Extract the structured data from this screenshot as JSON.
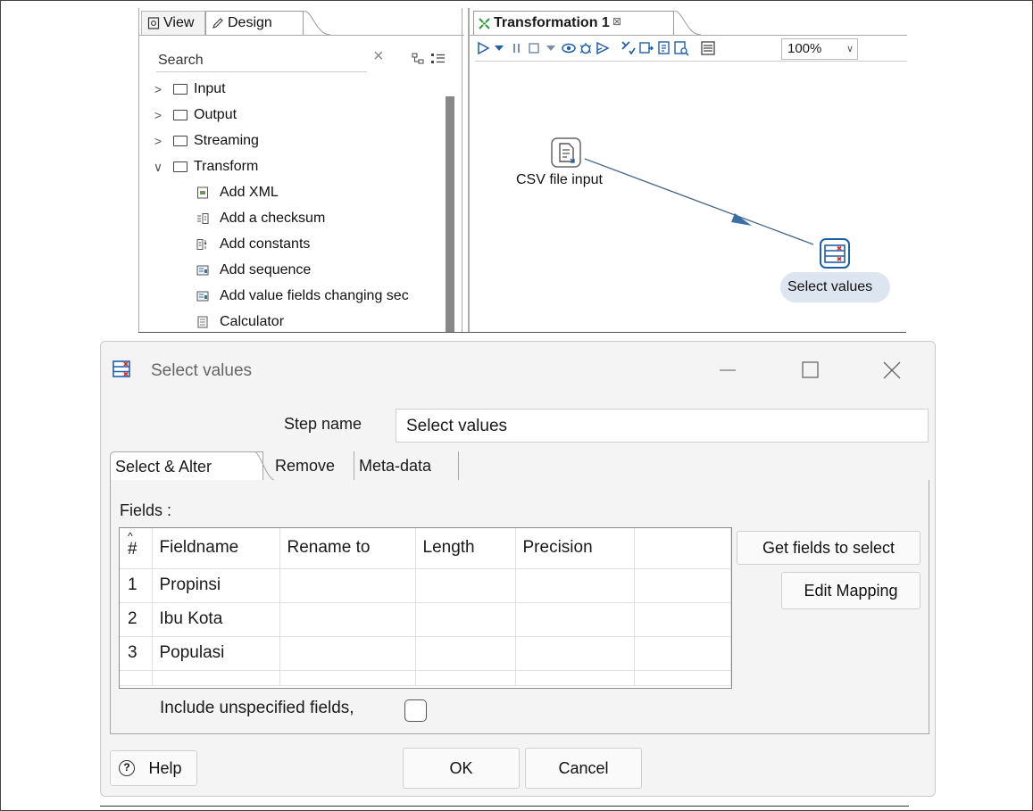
{
  "left_panel": {
    "tabs": [
      {
        "label": "View",
        "icon": "view-icon"
      },
      {
        "label": "Design",
        "icon": "pencil-icon"
      }
    ],
    "search_placeholder": "Search",
    "tree": [
      {
        "label": "Input",
        "expanded": false
      },
      {
        "label": "Output",
        "expanded": false
      },
      {
        "label": "Streaming",
        "expanded": false
      },
      {
        "label": "Transform",
        "expanded": true
      }
    ],
    "transform_steps": [
      {
        "label": "Add XML",
        "icon": "add-xml-icon"
      },
      {
        "label": "Add a checksum",
        "icon": "checksum-icon"
      },
      {
        "label": "Add constants",
        "icon": "constants-icon"
      },
      {
        "label": "Add sequence",
        "icon": "sequence-icon"
      },
      {
        "label": "Add value fields changing sec",
        "icon": "value-fields-icon"
      },
      {
        "label": "Calculator",
        "icon": "calculator-icon"
      }
    ]
  },
  "editor": {
    "tab_title": "Transformation 1",
    "zoom": "100%",
    "steps": [
      {
        "label": "CSV file input",
        "icon": "csv-file-icon"
      },
      {
        "label": "Select values",
        "icon": "select-values-icon",
        "selected": true
      }
    ]
  },
  "dialog": {
    "title": "Select values",
    "step_name_label": "Step name",
    "step_name_value": "Select values",
    "tabs": [
      "Select & Alter",
      "Remove",
      "Meta-data"
    ],
    "active_tab": "Select & Alter",
    "fields_label": "Fields :",
    "columns": [
      "#",
      "Fieldname",
      "Rename to",
      "Length",
      "Precision",
      ""
    ],
    "rows": [
      {
        "num": "1",
        "fieldname": "Propinsi"
      },
      {
        "num": "2",
        "fieldname": "Ibu Kota"
      },
      {
        "num": "3",
        "fieldname": "Populasi"
      }
    ],
    "get_fields_label": "Get fields to select",
    "edit_mapping_label": "Edit Mapping",
    "include_label": "Include unspecified fields,",
    "include_checked": false,
    "help_label": "Help",
    "ok_label": "OK",
    "cancel_label": "Cancel"
  },
  "colors": {
    "accent_blue": "#1f5fa8",
    "green_icon": "#2e9e3e",
    "dialog_bg": "#f4f4f4",
    "selection_bg": "#dde6f0"
  }
}
